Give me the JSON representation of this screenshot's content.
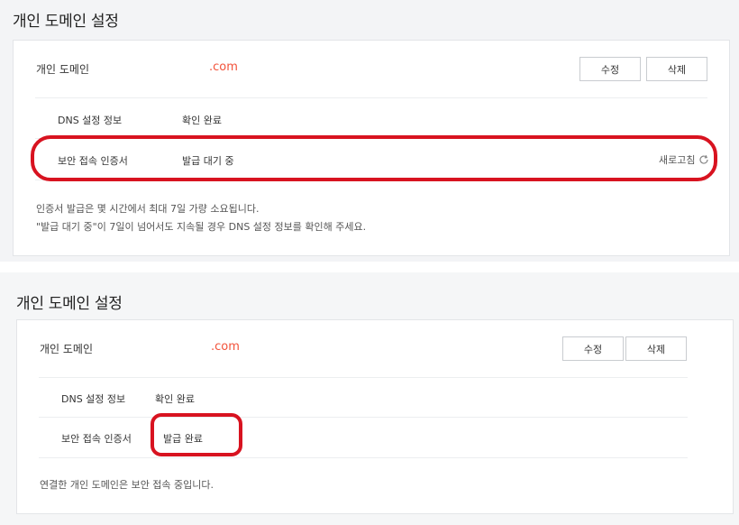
{
  "before": {
    "title": "개인 도메인 설정",
    "domain_label": "개인 도메인",
    "domain_value": ".com",
    "edit_button": "수정",
    "delete_button": "삭제",
    "rows": [
      {
        "key": "DNS 설정 정보",
        "value": "확인 완료"
      },
      {
        "key": "보안 접속 인증서",
        "value": "발급 대기 중"
      }
    ],
    "refresh_label": "새로고침",
    "notes": [
      "인증서 발급은 몇 시간에서 최대 7일 가량 소요됩니다.",
      "\"발급 대기 중\"이 7일이 넘어서도 지속될 경우 DNS 설정 정보를 확인해 주세요."
    ]
  },
  "after": {
    "title": "개인 도메인 설정",
    "domain_label": "개인 도메인",
    "domain_value": ".com",
    "edit_button": "수정",
    "delete_button": "삭제",
    "rows": [
      {
        "key": "DNS 설정 정보",
        "value": "확인 완료"
      },
      {
        "key": "보안 접속 인증서",
        "value": "발급 완료"
      }
    ],
    "note": "연결한 개인 도메인은 보안 접속 중입니다."
  },
  "colors": {
    "domain_accent": "#f2523a",
    "highlight": "#d81320"
  }
}
